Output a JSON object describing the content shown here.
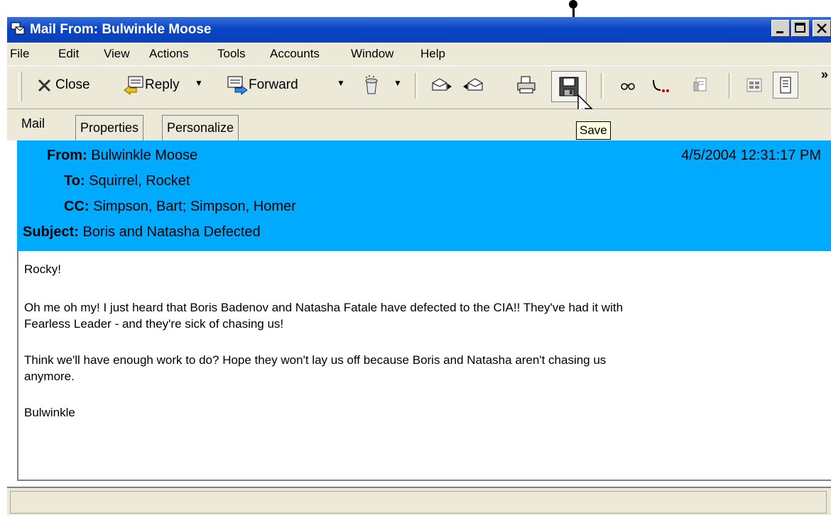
{
  "window": {
    "title": "Mail From: Bulwinkle Moose"
  },
  "menu": [
    "File",
    "Edit",
    "View",
    "Actions",
    "Tools",
    "Accounts",
    "Window",
    "Help"
  ],
  "toolbar": {
    "close_label": "Close",
    "reply_label": "Reply",
    "forward_label": "Forward",
    "more_label": "»"
  },
  "tabs": [
    "Mail",
    "Properties",
    "Personalize"
  ],
  "tooltip": "Save",
  "message": {
    "from_label": "From:",
    "from": "Bulwinkle Moose",
    "to_label": "To:",
    "to": "Squirrel, Rocket",
    "cc_label": "CC:",
    "cc": "Simpson, Bart; Simpson, Homer",
    "subject_label": "Subject:",
    "subject": "Boris and Natasha Defected",
    "date": "4/5/2004 12:31:17 PM"
  },
  "body": {
    "line1": "Rocky!",
    "line2": "Oh me oh my!  I just heard that Boris Badenov and Natasha Fatale have defected to the CIA!!  They've had it with",
    "line3": "Fearless Leader - and they're sick of chasing us!",
    "line4": "Think we'll have enough work to do?  Hope they won't lay us off because Boris and Natasha aren't chasing us",
    "line5": "anymore.",
    "line6": "Bulwinkle"
  },
  "colors": {
    "titlebar": "#0a45c8",
    "header_bg": "#00aaff",
    "chrome": "#ece9d8",
    "tooltip_bg": "#ffffe1"
  }
}
